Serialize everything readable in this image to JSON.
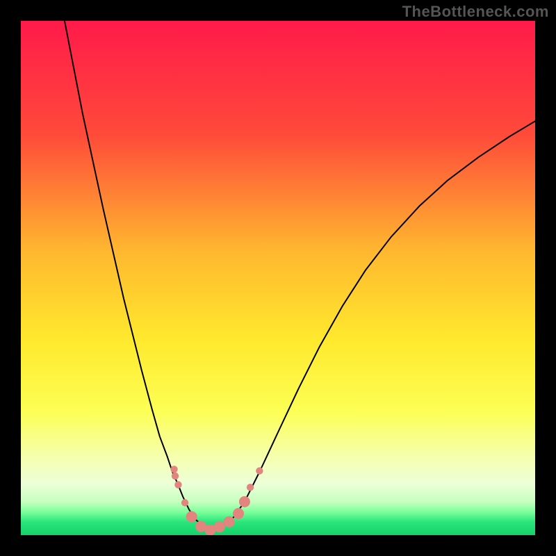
{
  "watermark": "TheBottleneck.com",
  "chart_data": {
    "type": "line",
    "title": "",
    "xlabel": "",
    "ylabel": "",
    "xlim": [
      0,
      100
    ],
    "ylim": [
      0,
      100
    ],
    "grid": false,
    "legend": false,
    "background_gradient_stops": [
      {
        "offset": 0.0,
        "color": "#ff1a4a"
      },
      {
        "offset": 0.22,
        "color": "#ff4a3a"
      },
      {
        "offset": 0.45,
        "color": "#ffb82f"
      },
      {
        "offset": 0.62,
        "color": "#ffe92d"
      },
      {
        "offset": 0.76,
        "color": "#fcff55"
      },
      {
        "offset": 0.85,
        "color": "#f5ffb0"
      },
      {
        "offset": 0.9,
        "color": "#ecffd8"
      },
      {
        "offset": 0.935,
        "color": "#c7ffbf"
      },
      {
        "offset": 0.955,
        "color": "#7bff9a"
      },
      {
        "offset": 0.975,
        "color": "#28e47a"
      },
      {
        "offset": 1.0,
        "color": "#14d26a"
      }
    ],
    "series": [
      {
        "name": "left-branch",
        "stroke": "#000000",
        "stroke_width": 2,
        "x": [
          8.5,
          12.0,
          16.0,
          20.0,
          23.5,
          25.5,
          27.0,
          28.5,
          29.5,
          30.5,
          31.5,
          32.7,
          34.0,
          35.5,
          37.0
        ],
        "y": [
          100.0,
          82.0,
          63.5,
          46.0,
          32.0,
          24.5,
          19.2,
          15.2,
          12.2,
          10.0,
          7.5,
          5.0,
          3.0,
          1.8,
          1.0
        ]
      },
      {
        "name": "right-branch",
        "stroke": "#000000",
        "stroke_width": 2,
        "x": [
          37.0,
          39.0,
          41.0,
          43.5,
          46.5,
          50.0,
          54.0,
          58.0,
          62.5,
          67.0,
          72.0,
          77.5,
          83.0,
          89.0,
          95.0,
          100.0
        ],
        "y": [
          1.0,
          1.8,
          3.0,
          6.5,
          12.5,
          20.0,
          28.5,
          36.5,
          44.5,
          51.5,
          58.0,
          64.0,
          69.0,
          73.5,
          77.5,
          80.5
        ]
      }
    ],
    "markers": {
      "name": "highlight-dots",
      "fill": "#e2857f",
      "radius_small": 5.2,
      "radius_large": 8.0,
      "points": [
        {
          "x": 29.8,
          "y": 12.8,
          "r": "small"
        },
        {
          "x": 30.0,
          "y": 11.5,
          "r": "small"
        },
        {
          "x": 30.6,
          "y": 9.8,
          "r": "small"
        },
        {
          "x": 31.9,
          "y": 6.3,
          "r": "small"
        },
        {
          "x": 33.2,
          "y": 3.6,
          "r": "large"
        },
        {
          "x": 35.0,
          "y": 1.7,
          "r": "large"
        },
        {
          "x": 36.8,
          "y": 1.0,
          "r": "large"
        },
        {
          "x": 38.6,
          "y": 1.6,
          "r": "large"
        },
        {
          "x": 40.5,
          "y": 2.6,
          "r": "large"
        },
        {
          "x": 42.3,
          "y": 4.2,
          "r": "large"
        },
        {
          "x": 43.5,
          "y": 6.5,
          "r": "large"
        },
        {
          "x": 44.6,
          "y": 9.3,
          "r": "small"
        },
        {
          "x": 46.4,
          "y": 12.5,
          "r": "small"
        }
      ]
    }
  }
}
